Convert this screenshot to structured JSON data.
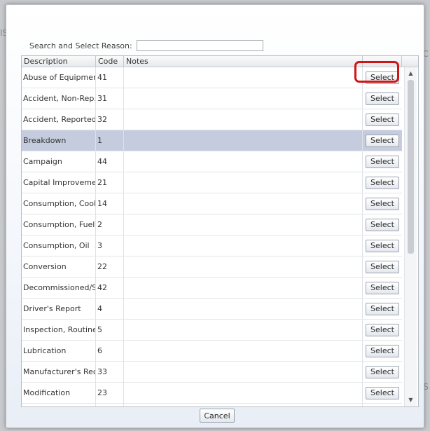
{
  "background": {
    "ghost_left": "IS",
    "ghost_right_top": "AC",
    "ghost_right_bottom": "S"
  },
  "search": {
    "label": "Search and Select Reason:",
    "value": "",
    "placeholder": ""
  },
  "columns": {
    "description": "Description",
    "code": "Code",
    "notes": "Notes",
    "select": ""
  },
  "select_label": "Select",
  "rows": [
    {
      "description": "Abuse of Equipment",
      "code": "41",
      "notes": ""
    },
    {
      "description": "Accident, Non-Rep...",
      "code": "31",
      "notes": ""
    },
    {
      "description": "Accident, Reported",
      "code": "32",
      "notes": ""
    },
    {
      "description": "Breakdown",
      "code": "1",
      "notes": "",
      "selected": true
    },
    {
      "description": "Campaign",
      "code": "44",
      "notes": ""
    },
    {
      "description": "Capital Improvement",
      "code": "21",
      "notes": ""
    },
    {
      "description": "Consumption, Cool...",
      "code": "14",
      "notes": ""
    },
    {
      "description": "Consumption, Fuel",
      "code": "2",
      "notes": ""
    },
    {
      "description": "Consumption, Oil",
      "code": "3",
      "notes": ""
    },
    {
      "description": "Conversion",
      "code": "22",
      "notes": ""
    },
    {
      "description": "Decommissioned/S...",
      "code": "42",
      "notes": ""
    },
    {
      "description": "Driver's Report",
      "code": "4",
      "notes": ""
    },
    {
      "description": "Inspection, Routine",
      "code": "5",
      "notes": ""
    },
    {
      "description": "Lubrication",
      "code": "6",
      "notes": ""
    },
    {
      "description": "Manufacturer's Recall",
      "code": "33",
      "notes": ""
    },
    {
      "description": "Modification",
      "code": "23",
      "notes": ""
    },
    {
      "description": "",
      "code": "",
      "notes": ""
    }
  ],
  "cancel_label": "Cancel",
  "colors": {
    "selected_row": "#c4ccde",
    "highlight_ring": "#d01515"
  },
  "icons": {
    "scroll_up": "scroll-up-arrow-icon",
    "scroll_down": "scroll-down-arrow-icon"
  }
}
